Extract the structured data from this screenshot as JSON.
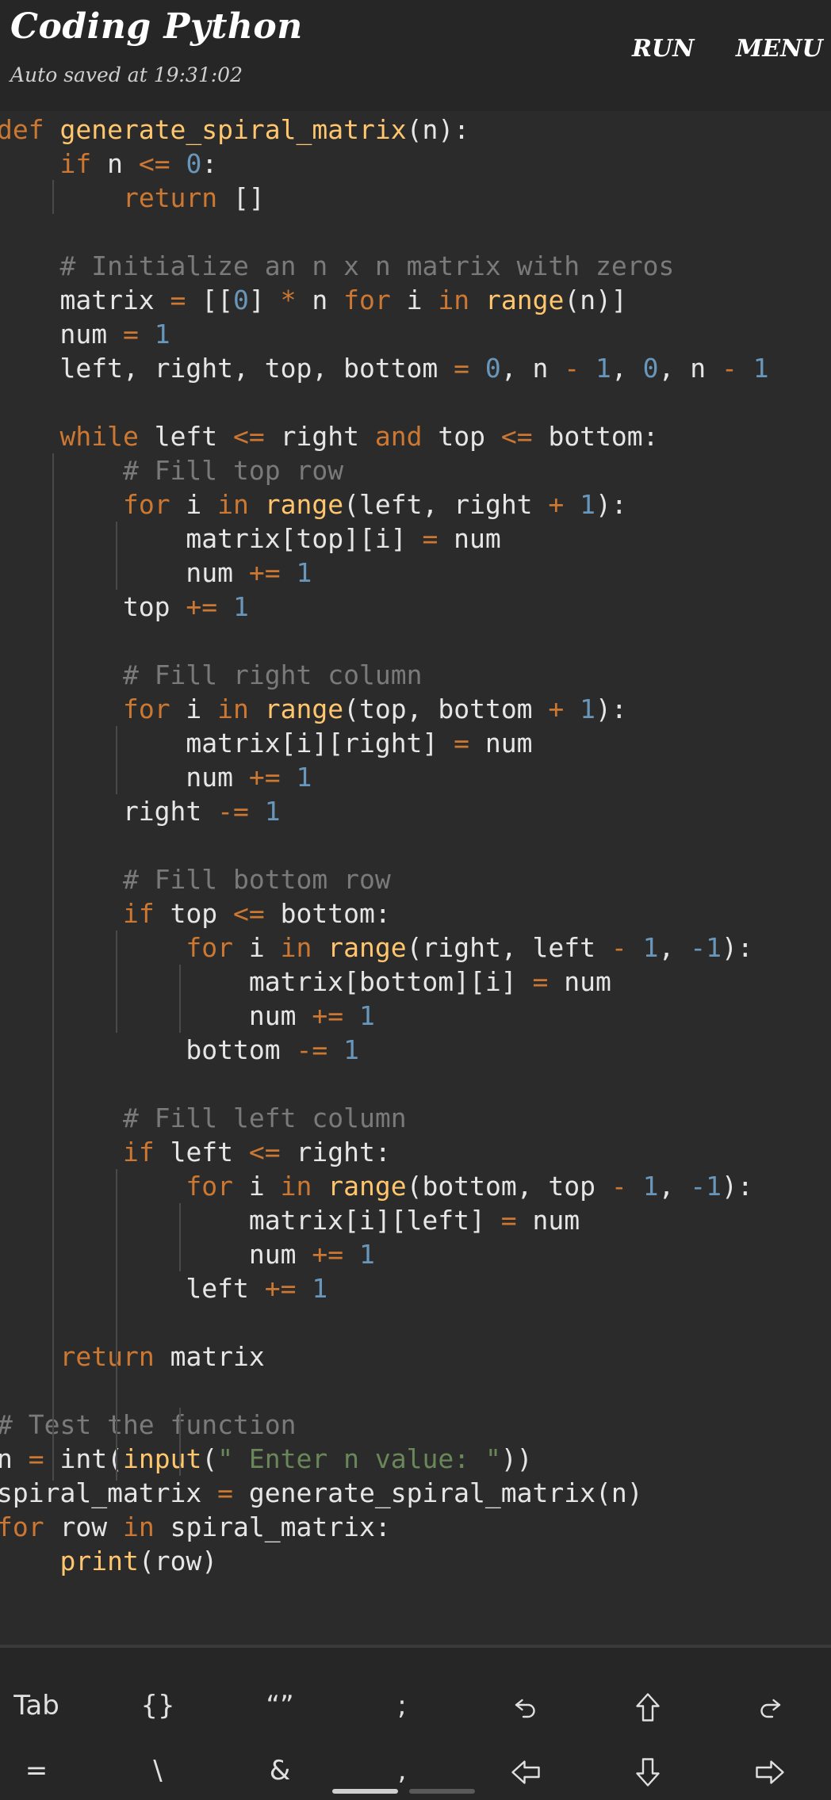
{
  "header": {
    "title": "Coding Python",
    "subtitle": "Auto saved at 19:31:02",
    "run_label": "RUN",
    "menu_label": "MENU"
  },
  "code_lines": [
    [
      [
        "k",
        "def"
      ],
      [
        "t",
        " "
      ],
      [
        "f",
        "generate_spiral_matrix"
      ],
      [
        "t",
        "(n):"
      ]
    ],
    [
      [
        "t",
        "    "
      ],
      [
        "k",
        "if"
      ],
      [
        "t",
        " n "
      ],
      [
        "k",
        "<="
      ],
      [
        "t",
        " "
      ],
      [
        "n",
        "0"
      ],
      [
        "t",
        ":"
      ]
    ],
    [
      [
        "t",
        "        "
      ],
      [
        "k",
        "return"
      ],
      [
        "t",
        " []"
      ]
    ],
    [],
    [
      [
        "t",
        "    "
      ],
      [
        "c",
        "# Initialize an n x n matrix with zeros"
      ]
    ],
    [
      [
        "t",
        "    matrix "
      ],
      [
        "k",
        "="
      ],
      [
        "t",
        " [["
      ],
      [
        "n",
        "0"
      ],
      [
        "t",
        "] "
      ],
      [
        "k",
        "*"
      ],
      [
        "t",
        " n "
      ],
      [
        "k",
        "for"
      ],
      [
        "t",
        " i "
      ],
      [
        "k",
        "in"
      ],
      [
        "t",
        " "
      ],
      [
        "f",
        "range"
      ],
      [
        "t",
        "(n)]"
      ]
    ],
    [
      [
        "t",
        "    num "
      ],
      [
        "k",
        "="
      ],
      [
        "t",
        " "
      ],
      [
        "n",
        "1"
      ]
    ],
    [
      [
        "t",
        "    left, right, top, bottom "
      ],
      [
        "k",
        "="
      ],
      [
        "t",
        " "
      ],
      [
        "n",
        "0"
      ],
      [
        "t",
        ", n "
      ],
      [
        "k",
        "-"
      ],
      [
        "t",
        " "
      ],
      [
        "n",
        "1"
      ],
      [
        "t",
        ", "
      ],
      [
        "n",
        "0"
      ],
      [
        "t",
        ", n "
      ],
      [
        "k",
        "-"
      ],
      [
        "t",
        " "
      ],
      [
        "n",
        "1"
      ]
    ],
    [],
    [
      [
        "t",
        "    "
      ],
      [
        "k",
        "while"
      ],
      [
        "t",
        " left "
      ],
      [
        "k",
        "<="
      ],
      [
        "t",
        " right "
      ],
      [
        "k",
        "and"
      ],
      [
        "t",
        " top "
      ],
      [
        "k",
        "<="
      ],
      [
        "t",
        " bottom:"
      ]
    ],
    [
      [
        "t",
        "        "
      ],
      [
        "c",
        "# Fill top row"
      ]
    ],
    [
      [
        "t",
        "        "
      ],
      [
        "k",
        "for"
      ],
      [
        "t",
        " i "
      ],
      [
        "k",
        "in"
      ],
      [
        "t",
        " "
      ],
      [
        "f",
        "range"
      ],
      [
        "t",
        "(left, right "
      ],
      [
        "k",
        "+"
      ],
      [
        "t",
        " "
      ],
      [
        "n",
        "1"
      ],
      [
        "t",
        "):"
      ]
    ],
    [
      [
        "t",
        "            matrix[top][i] "
      ],
      [
        "k",
        "="
      ],
      [
        "t",
        " num"
      ]
    ],
    [
      [
        "t",
        "            num "
      ],
      [
        "k",
        "+="
      ],
      [
        "t",
        " "
      ],
      [
        "n",
        "1"
      ]
    ],
    [
      [
        "t",
        "        top "
      ],
      [
        "k",
        "+="
      ],
      [
        "t",
        " "
      ],
      [
        "n",
        "1"
      ]
    ],
    [],
    [
      [
        "t",
        "        "
      ],
      [
        "c",
        "# Fill right column"
      ]
    ],
    [
      [
        "t",
        "        "
      ],
      [
        "k",
        "for"
      ],
      [
        "t",
        " i "
      ],
      [
        "k",
        "in"
      ],
      [
        "t",
        " "
      ],
      [
        "f",
        "range"
      ],
      [
        "t",
        "(top, bottom "
      ],
      [
        "k",
        "+"
      ],
      [
        "t",
        " "
      ],
      [
        "n",
        "1"
      ],
      [
        "t",
        "):"
      ]
    ],
    [
      [
        "t",
        "            matrix[i][right] "
      ],
      [
        "k",
        "="
      ],
      [
        "t",
        " num"
      ]
    ],
    [
      [
        "t",
        "            num "
      ],
      [
        "k",
        "+="
      ],
      [
        "t",
        " "
      ],
      [
        "n",
        "1"
      ]
    ],
    [
      [
        "t",
        "        right "
      ],
      [
        "k",
        "-="
      ],
      [
        "t",
        " "
      ],
      [
        "n",
        "1"
      ]
    ],
    [],
    [
      [
        "t",
        "        "
      ],
      [
        "c",
        "# Fill bottom row"
      ]
    ],
    [
      [
        "t",
        "        "
      ],
      [
        "k",
        "if"
      ],
      [
        "t",
        " top "
      ],
      [
        "k",
        "<="
      ],
      [
        "t",
        " bottom:"
      ]
    ],
    [
      [
        "t",
        "            "
      ],
      [
        "k",
        "for"
      ],
      [
        "t",
        " i "
      ],
      [
        "k",
        "in"
      ],
      [
        "t",
        " "
      ],
      [
        "f",
        "range"
      ],
      [
        "t",
        "(right, left "
      ],
      [
        "k",
        "-"
      ],
      [
        "t",
        " "
      ],
      [
        "n",
        "1"
      ],
      [
        "t",
        ", "
      ],
      [
        "n",
        "-1"
      ],
      [
        "t",
        "):"
      ]
    ],
    [
      [
        "t",
        "                matrix[bottom][i] "
      ],
      [
        "k",
        "="
      ],
      [
        "t",
        " num"
      ]
    ],
    [
      [
        "t",
        "                num "
      ],
      [
        "k",
        "+="
      ],
      [
        "t",
        " "
      ],
      [
        "n",
        "1"
      ]
    ],
    [
      [
        "t",
        "            bottom "
      ],
      [
        "k",
        "-="
      ],
      [
        "t",
        " "
      ],
      [
        "n",
        "1"
      ]
    ],
    [],
    [
      [
        "t",
        "        "
      ],
      [
        "c",
        "# Fill left column"
      ]
    ],
    [
      [
        "t",
        "        "
      ],
      [
        "k",
        "if"
      ],
      [
        "t",
        " left "
      ],
      [
        "k",
        "<="
      ],
      [
        "t",
        " right:"
      ]
    ],
    [
      [
        "t",
        "            "
      ],
      [
        "k",
        "for"
      ],
      [
        "t",
        " i "
      ],
      [
        "k",
        "in"
      ],
      [
        "t",
        " "
      ],
      [
        "f",
        "range"
      ],
      [
        "t",
        "(bottom, top "
      ],
      [
        "k",
        "-"
      ],
      [
        "t",
        " "
      ],
      [
        "n",
        "1"
      ],
      [
        "t",
        ", "
      ],
      [
        "n",
        "-1"
      ],
      [
        "t",
        "):"
      ]
    ],
    [
      [
        "t",
        "                matrix[i][left] "
      ],
      [
        "k",
        "="
      ],
      [
        "t",
        " num"
      ]
    ],
    [
      [
        "t",
        "                num "
      ],
      [
        "k",
        "+="
      ],
      [
        "t",
        " "
      ],
      [
        "n",
        "1"
      ]
    ],
    [
      [
        "t",
        "            left "
      ],
      [
        "k",
        "+="
      ],
      [
        "t",
        " "
      ],
      [
        "n",
        "1"
      ]
    ],
    [],
    [
      [
        "t",
        "    "
      ],
      [
        "k",
        "return"
      ],
      [
        "t",
        " matrix"
      ]
    ],
    [],
    [
      [
        "c",
        "# Test the function"
      ]
    ],
    [
      [
        "t",
        "n "
      ],
      [
        "k",
        "="
      ],
      [
        "t",
        " int("
      ],
      [
        "f",
        "input"
      ],
      [
        "t",
        "("
      ],
      [
        "s",
        "\" Enter n value: \""
      ],
      [
        "t",
        "))"
      ]
    ],
    [
      [
        "t",
        "spiral_matrix "
      ],
      [
        "k",
        "="
      ],
      [
        "t",
        " generate_spiral_matrix(n)"
      ]
    ],
    [
      [
        "k",
        "for"
      ],
      [
        "t",
        " row "
      ],
      [
        "k",
        "in"
      ],
      [
        "t",
        " spiral_matrix:"
      ]
    ],
    [
      [
        "t",
        "    "
      ],
      [
        "f",
        "print"
      ],
      [
        "t",
        "(row)"
      ]
    ]
  ],
  "keyboard": {
    "row1": [
      {
        "label": "Tab",
        "icon": "tab-key"
      },
      {
        "label": "{}",
        "icon": "braces-key"
      },
      {
        "label": "“”",
        "icon": "quotes-key"
      },
      {
        "label": ";",
        "icon": "semicolon-key"
      },
      {
        "label": "",
        "icon": "undo-icon"
      },
      {
        "label": "",
        "icon": "arrow-up-icon"
      },
      {
        "label": "",
        "icon": "redo-icon"
      }
    ],
    "row2": [
      {
        "label": "=",
        "icon": "equals-key"
      },
      {
        "label": "\\",
        "icon": "backslash-key"
      },
      {
        "label": "&",
        "icon": "ampersand-key"
      },
      {
        "label": ",",
        "icon": "comma-key"
      },
      {
        "label": "",
        "icon": "arrow-left-icon"
      },
      {
        "label": "",
        "icon": "arrow-down-icon"
      },
      {
        "label": "",
        "icon": "arrow-right-icon"
      }
    ]
  },
  "colors": {
    "background": "#2b2b2b",
    "keyword": "#cc7832",
    "function": "#ffc66d",
    "number": "#6897bb",
    "comment": "#7a7a7a",
    "string": "#6a8759",
    "text": "#e6e6e6"
  }
}
